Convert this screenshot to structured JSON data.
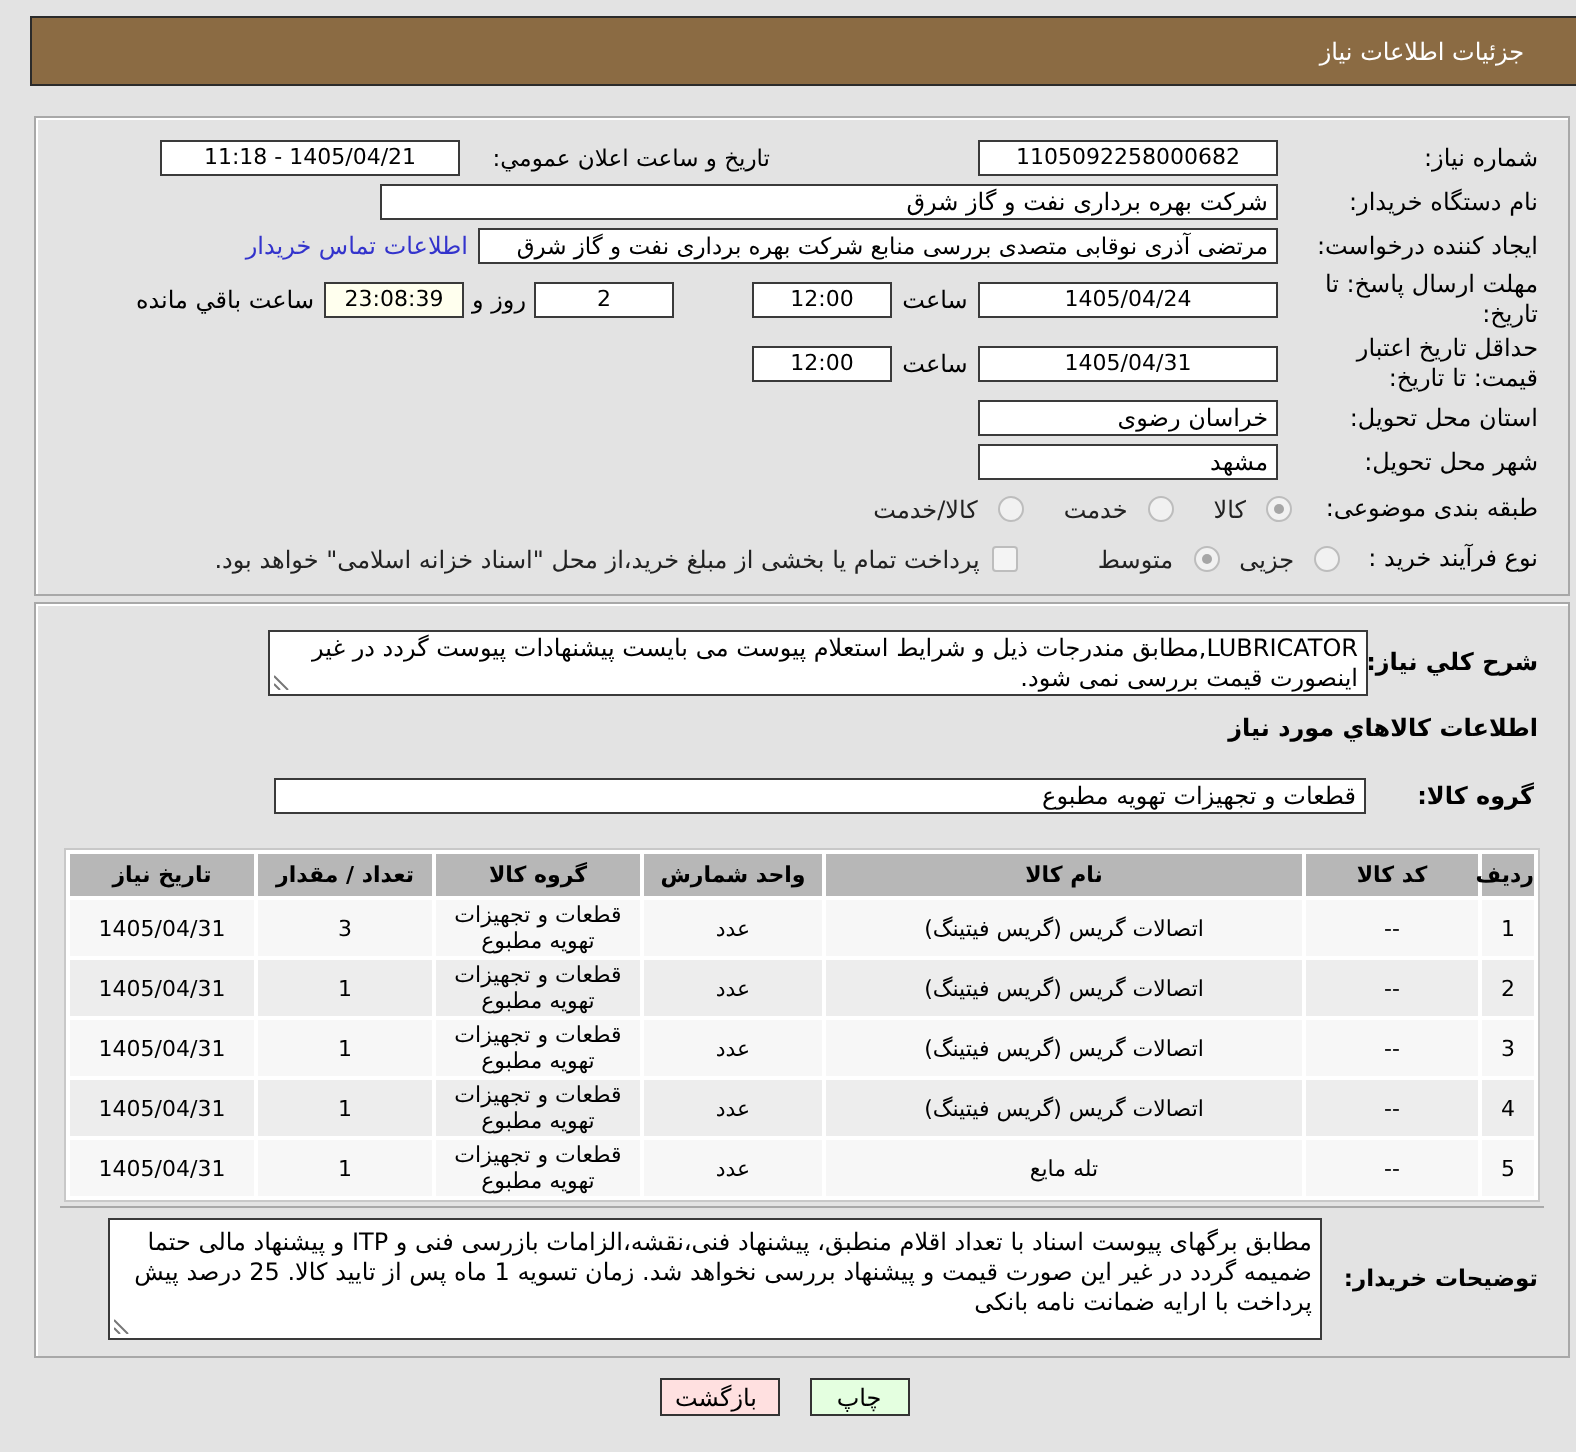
{
  "header": {
    "title": "جزئیات اطلاعات نیاز"
  },
  "details": {
    "need_number": {
      "label": "شماره نیاز:",
      "value": "1105092258000682"
    },
    "announce": {
      "label": "تاریخ و ساعت اعلان عمومي:",
      "value": "1405/04/21 - 11:18"
    },
    "buyer": {
      "label": "نام دستگاه خریدار:",
      "value": "شرکت بهره برداری نفت و گاز شرق"
    },
    "creator": {
      "label": "ایجاد کننده درخواست:",
      "value": "مرتضی آذری نوقابی متصدی بررسی منابع شرکت بهره برداری نفت و گاز شرق",
      "link": "اطلاعات تماس خریدار"
    },
    "deadline": {
      "label": "مهلت ارسال پاسخ: تا تاریخ:",
      "date": "1405/04/24",
      "time_label": "ساعت",
      "time": "12:00",
      "days": "2",
      "days_label": "روز و",
      "remaining": "23:08:39",
      "remaining_label": "ساعت باقي مانده"
    },
    "validity": {
      "label": "حداقل تاریخ اعتبار قیمت: تا تاریخ:",
      "date": "1405/04/31",
      "time_label": "ساعت",
      "time": "12:00"
    },
    "province": {
      "label": "استان محل تحویل:",
      "value": "خراسان رضوی"
    },
    "city": {
      "label": "شهر محل تحویل:",
      "value": "مشهد"
    },
    "category": {
      "label": "طبقه بندی موضوعی:",
      "options": [
        {
          "label": "کالا",
          "selected": true
        },
        {
          "label": "خدمت",
          "selected": false
        },
        {
          "label": "کالا/خدمت",
          "selected": false
        }
      ]
    },
    "process": {
      "label": "نوع فرآیند خرید :",
      "options": [
        {
          "label": "جزیی",
          "selected": false
        },
        {
          "label": "متوسط",
          "selected": true
        }
      ],
      "treasury": {
        "label": "پرداخت تمام یا بخشی از مبلغ خرید،از محل \"اسناد خزانه اسلامی\" خواهد بود.",
        "checked": false
      }
    }
  },
  "description": {
    "label": "شرح کلي نياز:",
    "value": "LUBRICATOR,مطابق مندرجات ذیل و شرایط استعلام پیوست می بایست پیشنهادات پیوست گردد در غیر اینصورت قیمت بررسی نمی شود."
  },
  "goods": {
    "title": "اطلاعات کالاهاي مورد نياز",
    "group": {
      "label": "گروه کالا:",
      "value": "قطعات و تجهیزات تهویه مطبوع"
    }
  },
  "table": {
    "columns": [
      "ردیف",
      "کد کالا",
      "نام کالا",
      "واحد شمارش",
      "گروه کالا",
      "تعداد / مقدار",
      "تاریخ نیاز"
    ],
    "rows": [
      [
        "1",
        "--",
        "اتصالات گریس (گریس فیتینگ)",
        "عدد",
        "قطعات و تجهیزات تهویه مطبوع",
        "3",
        "1405/04/31"
      ],
      [
        "2",
        "--",
        "اتصالات گریس (گریس فیتینگ)",
        "عدد",
        "قطعات و تجهیزات تهویه مطبوع",
        "1",
        "1405/04/31"
      ],
      [
        "3",
        "--",
        "اتصالات گریس (گریس فیتینگ)",
        "عدد",
        "قطعات و تجهیزات تهویه مطبوع",
        "1",
        "1405/04/31"
      ],
      [
        "4",
        "--",
        "اتصالات گریس (گریس فیتینگ)",
        "عدد",
        "قطعات و تجهیزات تهویه مطبوع",
        "1",
        "1405/04/31"
      ],
      [
        "5",
        "--",
        "تله مایع",
        "عدد",
        "قطعات و تجهیزات تهویه مطبوع",
        "1",
        "1405/04/31"
      ]
    ]
  },
  "buyer_notes": {
    "label": "توضیحات خریدار:",
    "value": "مطابق برگهای پیوست اسناد با تعداد اقلام منطبق، پیشنهاد فنی،نقشه،الزامات بازرسی فنی و ITP و پیشنهاد مالی حتما ضمیمه گردد در غیر این صورت قیمت و پیشنهاد بررسی نخواهد شد. زمان تسویه 1 ماه پس از تایید کالا. 25 درصد پیش پرداخت با ارایه ضمانت نامه بانکی"
  },
  "buttons": [
    {
      "label": "چاپ",
      "kind": "print"
    },
    {
      "label": "بازگشت",
      "kind": "back"
    }
  ]
}
